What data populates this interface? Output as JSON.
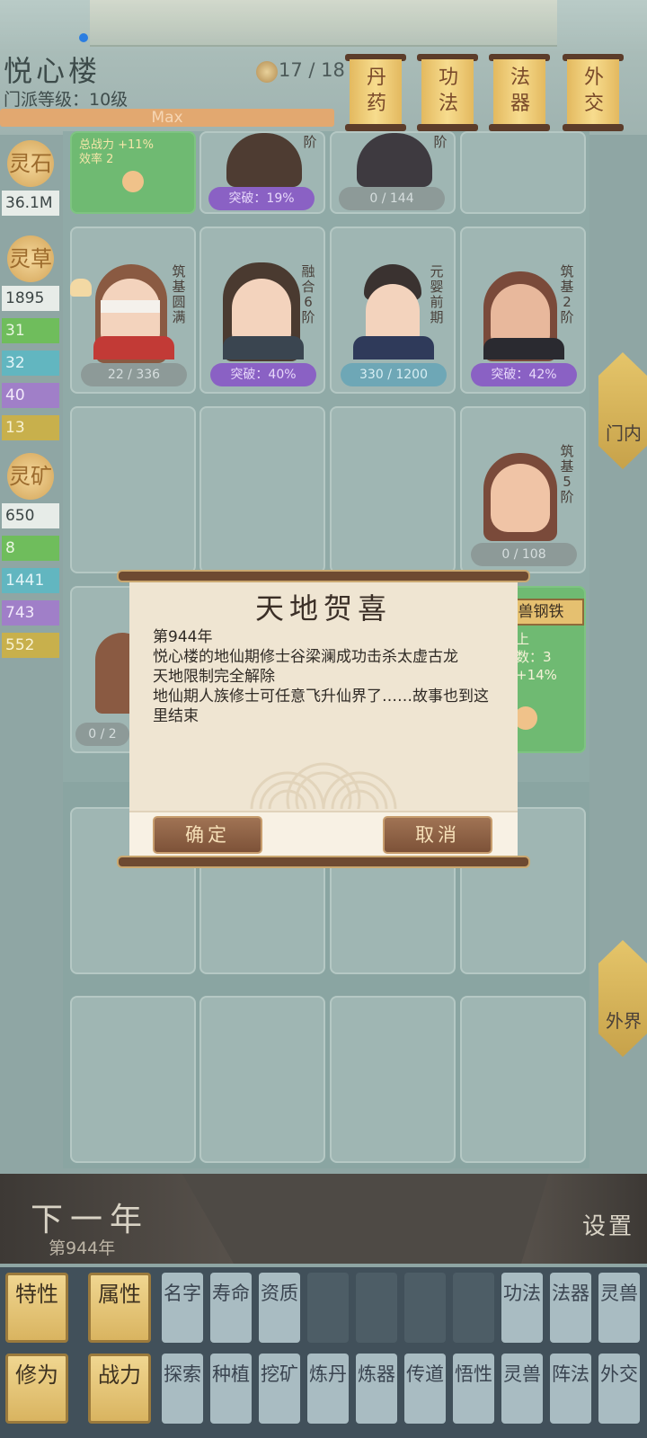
{
  "header": {
    "sect_name": "悦心楼",
    "sect_level": "门派等级：10级",
    "level_bar_label": "Max",
    "disciple_count": "17 / 18",
    "scrolls": [
      {
        "label": "丹药"
      },
      {
        "label": "功法"
      },
      {
        "label": "法器"
      },
      {
        "label": "外交"
      }
    ]
  },
  "resources": {
    "stone": {
      "icon_text": "灵石",
      "value": "36.1M"
    },
    "herb": {
      "icon_text": "灵草",
      "values": [
        "1895",
        "31",
        "32",
        "40",
        "13"
      ]
    },
    "ore": {
      "icon_text": "灵矿",
      "values": [
        "650",
        "8",
        "1441",
        "743",
        "552"
      ]
    }
  },
  "grid": {
    "row0": [
      {
        "type": "green",
        "text1": "总战力 +11%",
        "text2": "效率 2"
      },
      {
        "realm": "阶",
        "badge": "突破：19%",
        "badge_color": "purple"
      },
      {
        "realm": "阶",
        "badge": "0 / 144",
        "badge_color": "grey"
      },
      {
        "type": "empty"
      }
    ],
    "row1": [
      {
        "realm": "筑基圆满",
        "badge": "22 / 336",
        "badge_color": "grey"
      },
      {
        "realm": "融合6阶",
        "badge": "突破：40%",
        "badge_color": "purple"
      },
      {
        "realm": "元婴前期",
        "badge": "330 / 1200",
        "badge_color": "teal"
      },
      {
        "realm": "筑基2阶",
        "badge": "突破：42%",
        "badge_color": "purple"
      }
    ],
    "row2_last": {
      "realm": "筑基5阶",
      "badge": "0 / 108",
      "badge_color": "grey"
    },
    "row3_first": {
      "badge": "0 / 2"
    },
    "row3_last": {
      "title": "兽钢铁",
      "line1": "上",
      "line2": "数：3",
      "line3": "+14%"
    }
  },
  "side_tabs": {
    "inner": "门内",
    "outer": "外界"
  },
  "dialog": {
    "title": "天地贺喜",
    "lines": [
      "第944年",
      "悦心楼的地仙期修士谷梁澜成功击杀太虚古龙",
      "天地限制完全解除",
      "地仙期人族修士可任意飞升仙界了……故事也到这里结束"
    ],
    "confirm": "确定",
    "cancel": "取消"
  },
  "bottom": {
    "next_year": "下一年",
    "year_sub": "第944年",
    "settings": "设置"
  },
  "tabs_row1": [
    "特性",
    "属性",
    "名字",
    "寿命",
    "资质",
    "",
    "",
    "",
    "",
    "功法",
    "法器",
    "灵兽"
  ],
  "tabs_row2": [
    "修为",
    "战力",
    "探索",
    "种植",
    "挖矿",
    "炼丹",
    "炼器",
    "传道",
    "悟性",
    "灵兽",
    "阵法",
    "外交"
  ],
  "colors": {
    "accent_gold": "#d9b460",
    "dialog_paper": "#efe5d2",
    "button_brown": "#8d5e40",
    "purple_badge": "#8a61c4"
  }
}
